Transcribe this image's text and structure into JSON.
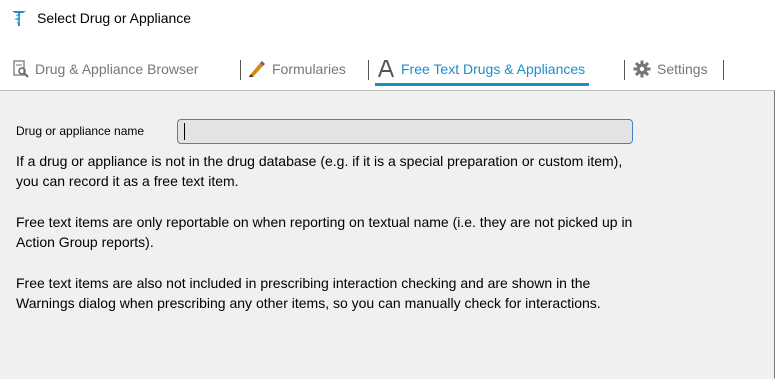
{
  "window": {
    "title": "Select Drug or Appliance",
    "icon": "caduceus-icon"
  },
  "tabs": [
    {
      "label": "Drug & Appliance Browser",
      "icon": "browser-search-icon",
      "active": false
    },
    {
      "label": "Formularies",
      "icon": "pencil-edit-icon",
      "active": false
    },
    {
      "label": "Free Text Drugs & Appliances",
      "icon": "letter-a-icon",
      "active": true
    },
    {
      "label": "Settings",
      "icon": "gear-icon",
      "active": false
    }
  ],
  "form": {
    "drug_name_label": "Drug or appliance name",
    "drug_name_value": ""
  },
  "info": {
    "paragraph1": "If a drug or appliance is not in the drug database (e.g. if it is a special preparation or custom item), you can record it as a free text item.",
    "paragraph2": "Free text items are only reportable on when reporting on textual name (i.e. they are not picked up in Action Group reports).",
    "paragraph3": "Free text items are also not included in prescribing interaction checking and are shown in the Warnings dialog when prescribing any other items, so you can manually check for interactions."
  },
  "colors": {
    "accent": "#1f8ccb",
    "inactive_tab": "#777777",
    "panel_background": "#f0f0f0"
  }
}
